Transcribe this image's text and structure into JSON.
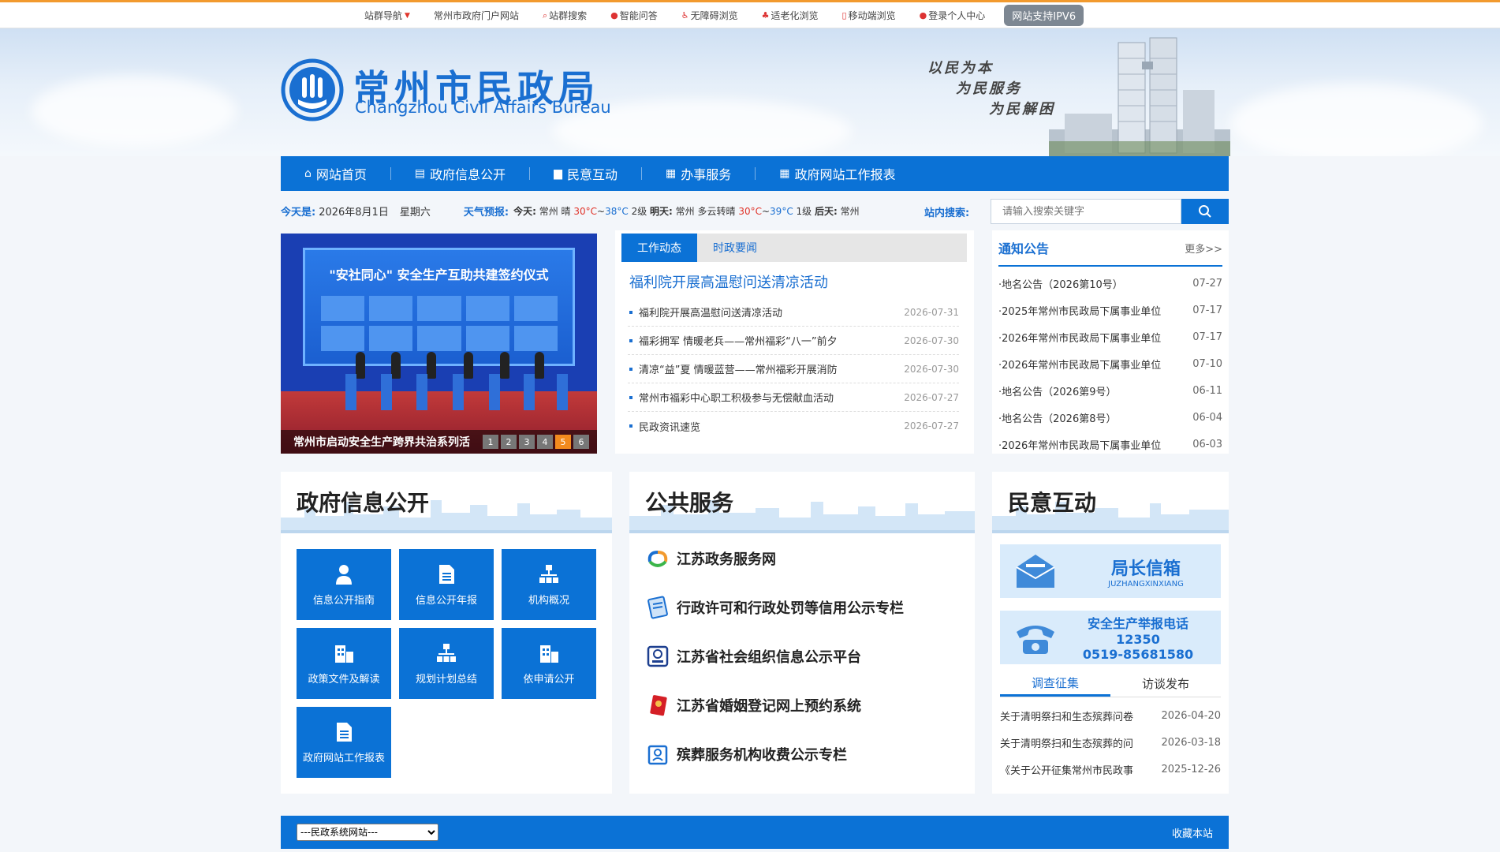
{
  "topbar": {
    "items": [
      {
        "label": "站群导航",
        "icon": "chevron-down-icon"
      },
      {
        "label": "常州市政府门户网站",
        "icon": ""
      },
      {
        "label": "站群搜索",
        "icon": "search-icon"
      },
      {
        "label": "智能问答",
        "icon": "robot-icon"
      },
      {
        "label": "无障碍浏览",
        "icon": "accessibility-icon"
      },
      {
        "label": "适老化浏览",
        "icon": "elder-icon"
      },
      {
        "label": "移动端浏览",
        "icon": "mobile-icon"
      },
      {
        "label": "登录个人中心",
        "icon": "user-icon"
      }
    ],
    "ipv6": "网站支持IPV6"
  },
  "header": {
    "title_cn": "常州市民政局",
    "title_en": "Changzhou Civil Affairs Bureau",
    "slogans": [
      "以民为本",
      "为民服务",
      "为民解困"
    ]
  },
  "nav": {
    "items": [
      {
        "label": "网站首页",
        "icon": "home-icon"
      },
      {
        "label": "政府信息公开",
        "icon": "document-icon"
      },
      {
        "label": "民意互动",
        "icon": "chat-icon"
      },
      {
        "label": "办事服务",
        "icon": "grid-icon"
      },
      {
        "label": "政府网站工作报表",
        "icon": "grid-icon"
      }
    ]
  },
  "infobar": {
    "today_label": "今天是:",
    "date": "2026年8月1日",
    "weekday": "星期六",
    "weather_label": "天气预报:",
    "weather": {
      "today_label": "今天:",
      "today_city": "常州 晴",
      "today_high": "30°C",
      "today_low": "38°C",
      "today_wind": "2级",
      "tomorrow_label": "明天:",
      "tomorrow_city": "常州 多云转晴",
      "tomorrow_high": "30°C",
      "tomorrow_low": "39°C",
      "tomorrow_wind": "1级",
      "after_label": "后天:",
      "after_city": "常州"
    },
    "search_label": "站内搜索:",
    "search_placeholder": "请输入搜索关键字"
  },
  "slider": {
    "banner": "\"安社同心\" 安全生产互助共建签约仪式",
    "caption": "常州市启动安全生产跨界共治系列活",
    "dots": [
      "1",
      "2",
      "3",
      "4",
      "5",
      "6"
    ],
    "active_dot": 5
  },
  "news": {
    "tabs": [
      "工作动态",
      "时政要闻"
    ],
    "headline": "福利院开展高温慰问送清凉活动",
    "items": [
      {
        "title": "福利院开展高温慰问送清凉活动",
        "date": "2026-07-31"
      },
      {
        "title": "福彩拥军 情暖老兵——常州福彩“八一”前夕",
        "date": "2026-07-30"
      },
      {
        "title": "清凉“益”夏 情暖蓝营——常州福彩开展消防",
        "date": "2026-07-30"
      },
      {
        "title": "常州市福彩中心职工积极参与无偿献血活动",
        "date": "2026-07-27"
      },
      {
        "title": "民政资讯速览",
        "date": "2026-07-27"
      }
    ]
  },
  "notice": {
    "title": "通知公告",
    "more": "更多>>",
    "items": [
      {
        "title": "·地名公告（2026第10号）",
        "date": "07-27"
      },
      {
        "title": "·2025年常州市民政局下属事业单位",
        "date": "07-17"
      },
      {
        "title": "·2026年常州市民政局下属事业单位",
        "date": "07-17"
      },
      {
        "title": "·2026年常州市民政局下属事业单位",
        "date": "07-10"
      },
      {
        "title": "·地名公告（2026第9号）",
        "date": "06-11"
      },
      {
        "title": "·地名公告（2026第8号）",
        "date": "06-04"
      },
      {
        "title": "·2026年常州市民政局下属事业单位",
        "date": "06-03"
      }
    ]
  },
  "gov": {
    "title": "政府信息公开",
    "tiles": [
      {
        "label": "信息公开指南",
        "icon": "person-icon"
      },
      {
        "label": "信息公开年报",
        "icon": "document-icon"
      },
      {
        "label": "机构概况",
        "icon": "org-chart-icon"
      },
      {
        "label": "政策文件及解读",
        "icon": "building-icon"
      },
      {
        "label": "规划计划总结",
        "icon": "org-chart-icon"
      },
      {
        "label": "依申请公开",
        "icon": "building-icon"
      },
      {
        "label": "政府网站工作报表",
        "icon": "document-icon"
      }
    ]
  },
  "services": {
    "title": "公共服务",
    "items": [
      {
        "label": "江苏政务服务网",
        "icon": "jiangsu-service-icon"
      },
      {
        "label": "行政许可和行政处罚等信用公示专栏",
        "icon": "certificate-icon"
      },
      {
        "label": "江苏省社会组织信息公示平台",
        "icon": "organization-icon"
      },
      {
        "label": "江苏省婚姻登记网上预约系统",
        "icon": "marriage-icon"
      },
      {
        "label": "殡葬服务机构收费公示专栏",
        "icon": "funeral-icon"
      }
    ]
  },
  "interaction": {
    "title": "民意互动",
    "mailbox_title": "局长信箱",
    "mailbox_sub": "JUZHANGXINXIANG",
    "hotline_title": "安全生产举报电话",
    "hotline_short": "12350",
    "hotline_full": "0519-85681580",
    "tabs": [
      "调查征集",
      "访谈发布"
    ],
    "items": [
      {
        "title": "关于清明祭扫和生态殡葬问卷",
        "date": "2026-04-20"
      },
      {
        "title": "关于清明祭扫和生态殡葬的问",
        "date": "2026-03-18"
      },
      {
        "title": "《关于公开征集常州市民政事",
        "date": "2025-12-26"
      }
    ]
  },
  "footer": {
    "select_value": "---民政系统网站---",
    "favorite": "收藏本站"
  },
  "colors": {
    "brand": "#0b72d6",
    "accent": "#f29a2e",
    "hot": "#e0352b"
  }
}
